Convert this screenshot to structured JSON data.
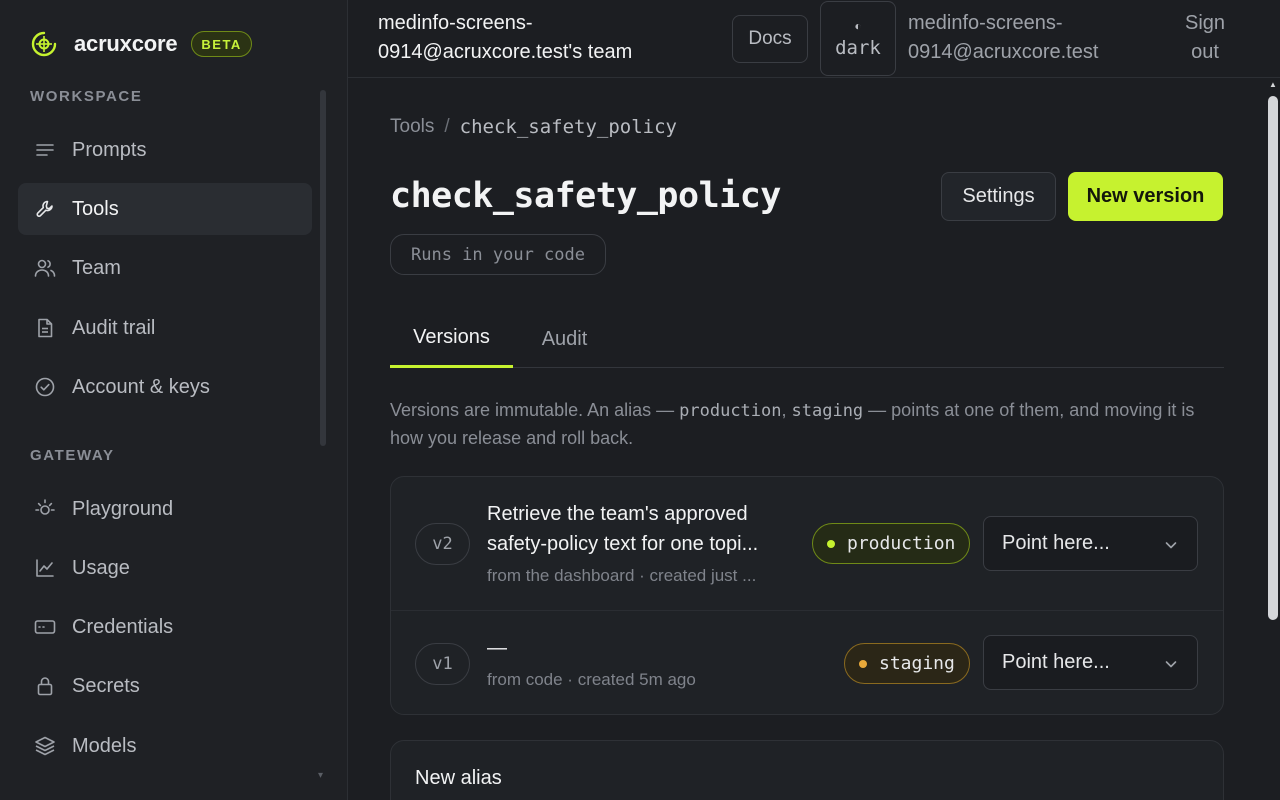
{
  "brand": {
    "name": "acruxcore",
    "badge": "BETA",
    "accent": "#c6f22f"
  },
  "sidebar": {
    "sections": [
      {
        "label": "WORKSPACE"
      },
      {
        "label": "GATEWAY"
      }
    ],
    "items": [
      {
        "label": "Prompts",
        "icon": "lines-icon"
      },
      {
        "label": "Tools",
        "icon": "wrench-icon",
        "active": true
      },
      {
        "label": "Team",
        "icon": "users-icon"
      },
      {
        "label": "Audit trail",
        "icon": "file-icon"
      },
      {
        "label": "Account & keys",
        "icon": "check-circle-icon"
      },
      {
        "label": "Playground",
        "icon": "sun-icon"
      },
      {
        "label": "Usage",
        "icon": "chart-icon"
      },
      {
        "label": "Credentials",
        "icon": "card-icon"
      },
      {
        "label": "Secrets",
        "icon": "lock-icon"
      },
      {
        "label": "Models",
        "icon": "layers-icon"
      }
    ]
  },
  "topbar": {
    "team": "medinfo-screens-0914@acruxcore.test's team",
    "docs": "Docs",
    "theme_glyph": "◐",
    "theme": "dark",
    "email": "medinfo-screens-0914@acruxcore.test",
    "signout": "Sign out"
  },
  "breadcrumb": {
    "parent": "Tools",
    "sep": "/",
    "current": "check_safety_policy"
  },
  "page": {
    "title": "check_safety_policy",
    "settings": "Settings",
    "new_version": "New version",
    "runs_badge": "Runs in your code"
  },
  "tabs": [
    {
      "label": "Versions",
      "active": true
    },
    {
      "label": "Audit"
    }
  ],
  "explain": {
    "part1": "Versions are immutable. An alias — ",
    "code1": "production",
    "part2": ", ",
    "code2": "staging",
    "part3": " — points at one of them, and moving it is how you release and roll back."
  },
  "versions": [
    {
      "badge": "v2",
      "description": "Retrieve the team's approved safety-policy text for one topi...",
      "meta": "from the dashboard · created just ...",
      "alias": "production",
      "select": "Point here..."
    },
    {
      "badge": "v1",
      "description": "—",
      "meta": "from code · created 5m ago",
      "alias": "staging",
      "select": "Point here..."
    }
  ],
  "new_alias": {
    "title": "New alias"
  }
}
